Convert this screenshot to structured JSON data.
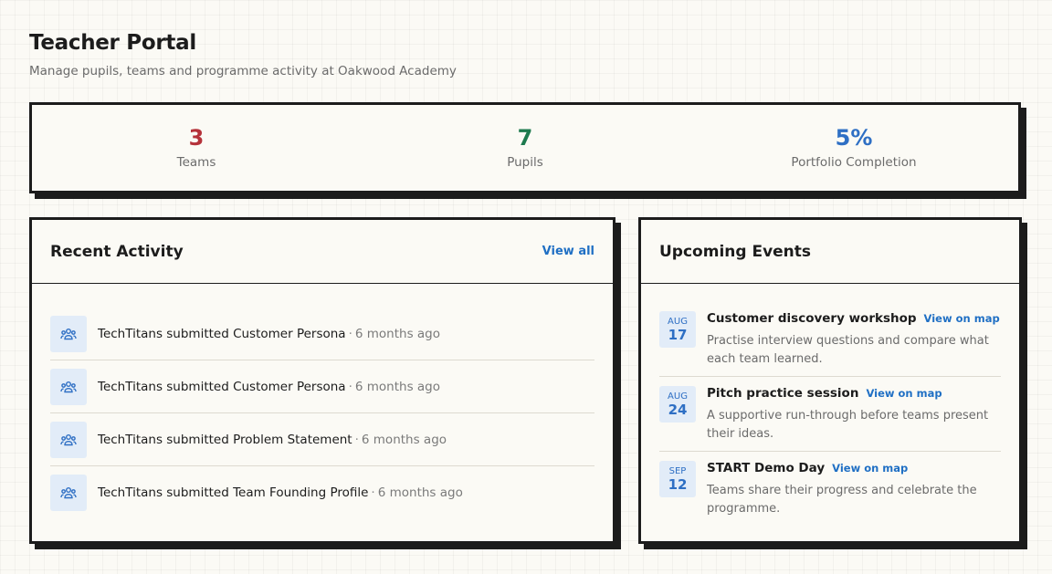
{
  "header": {
    "title": "Teacher Portal",
    "subtitle": "Manage pupils, teams and programme activity at Oakwood Academy"
  },
  "stats": [
    {
      "value": "3",
      "label": "Teams",
      "color": "#b5323a"
    },
    {
      "value": "7",
      "label": "Pupils",
      "color": "#1d7a4e"
    },
    {
      "value": "5%",
      "label": "Portfolio Completion",
      "color": "#2e6fc4"
    }
  ],
  "activity": {
    "title": "Recent Activity",
    "view_all": "View all",
    "items": [
      {
        "text": "TechTitans submitted Customer Persona",
        "time": "6 months ago",
        "icon": "team-icon"
      },
      {
        "text": "TechTitans submitted Customer Persona",
        "time": "6 months ago",
        "icon": "team-icon"
      },
      {
        "text": "TechTitans submitted Problem Statement",
        "time": "6 months ago",
        "icon": "team-icon"
      },
      {
        "text": "TechTitans submitted Team Founding Profile",
        "time": "6 months ago",
        "icon": "team-icon"
      }
    ]
  },
  "events": {
    "title": "Upcoming Events",
    "map_label": "View on map",
    "items": [
      {
        "month": "AUG",
        "day": "17",
        "title": "Customer discovery workshop",
        "desc": "Practise interview questions and compare what each team learned."
      },
      {
        "month": "AUG",
        "day": "24",
        "title": "Pitch practice session",
        "desc": "A supportive run-through before teams present their ideas."
      },
      {
        "month": "SEP",
        "day": "12",
        "title": "START Demo Day",
        "desc": "Teams share their progress and celebrate the programme."
      }
    ]
  }
}
